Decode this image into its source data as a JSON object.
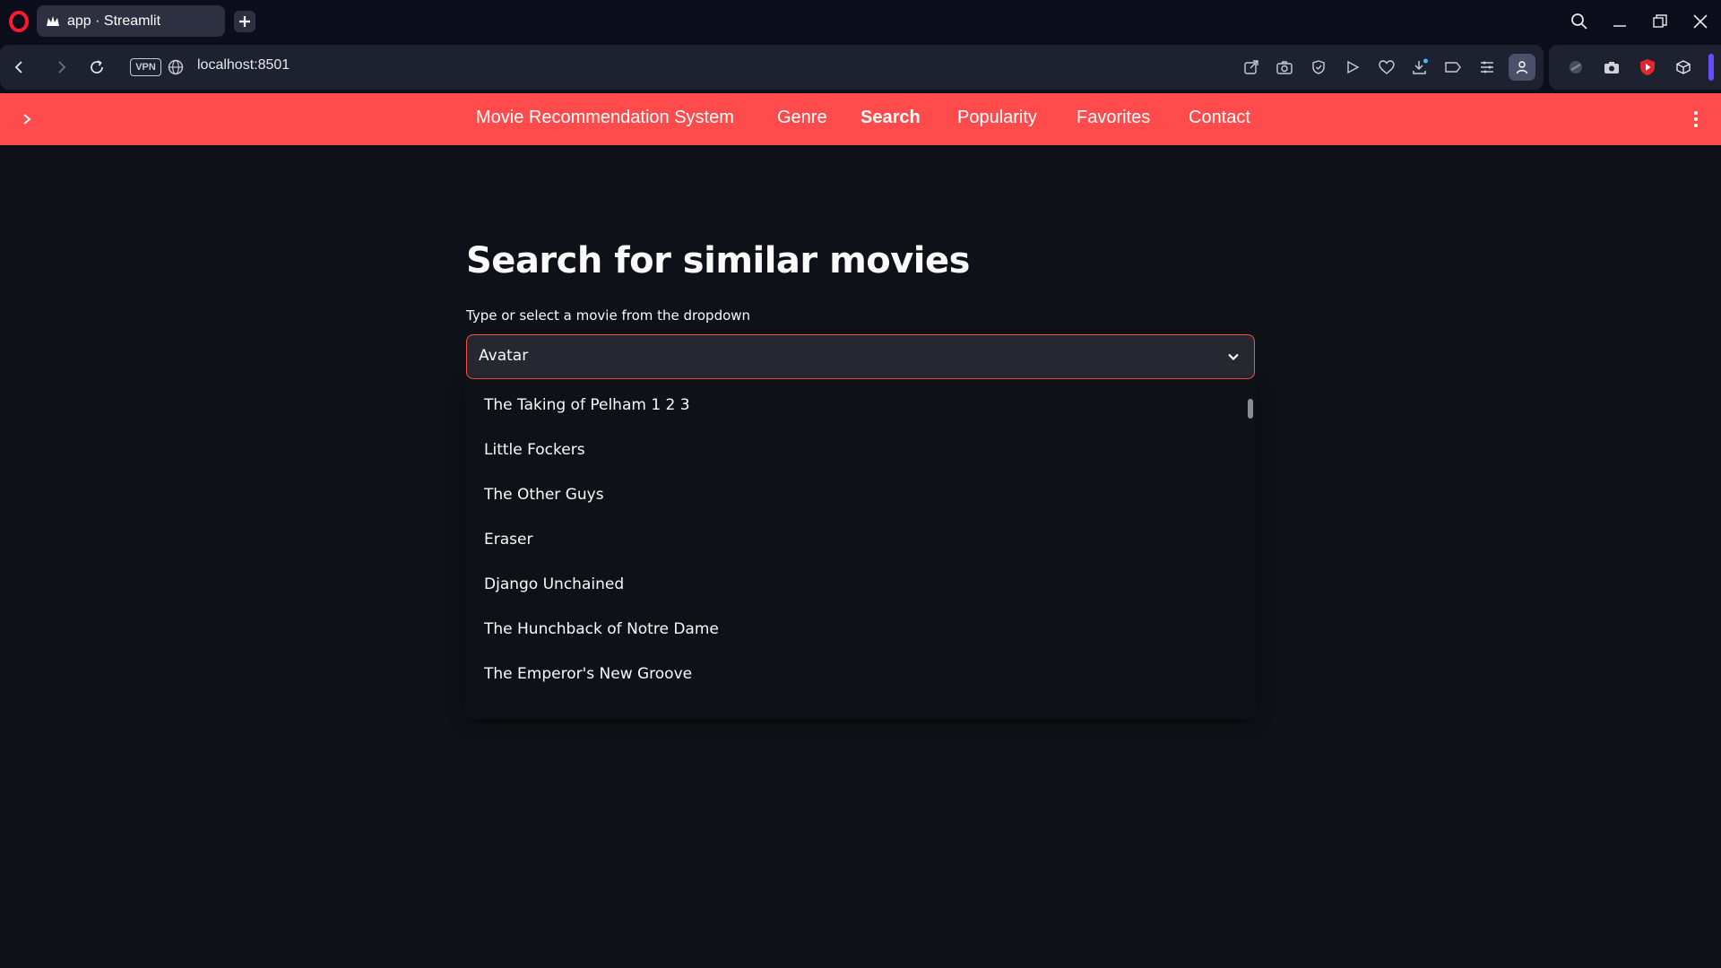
{
  "browser": {
    "tab_title": "app · Streamlit",
    "url": "localhost:8501",
    "vpn_label": "VPN"
  },
  "header": {
    "menu_items": [
      {
        "label": "Movie Recommendation System",
        "active": false
      },
      {
        "label": "Genre",
        "active": false
      },
      {
        "label": "Search",
        "active": true
      },
      {
        "label": "Popularity",
        "active": false
      },
      {
        "label": "Favorites",
        "active": false
      },
      {
        "label": "Contact",
        "active": false
      }
    ],
    "accent_color": "#ff4b4b"
  },
  "main": {
    "title": "Search for similar movies",
    "select_label": "Type or select a movie from the dropdown",
    "selected_movie": "Avatar",
    "options": [
      "The Taking of Pelham 1 2 3",
      "Little Fockers",
      "The Other Guys",
      "Eraser",
      "Django Unchained",
      "The Hunchback of Notre Dame",
      "The Emperor's New Groove"
    ]
  },
  "colors": {
    "background": "#0e1117",
    "select_background": "#262730",
    "text": "#fafafa",
    "browser_frame": "#0b0d1a"
  }
}
